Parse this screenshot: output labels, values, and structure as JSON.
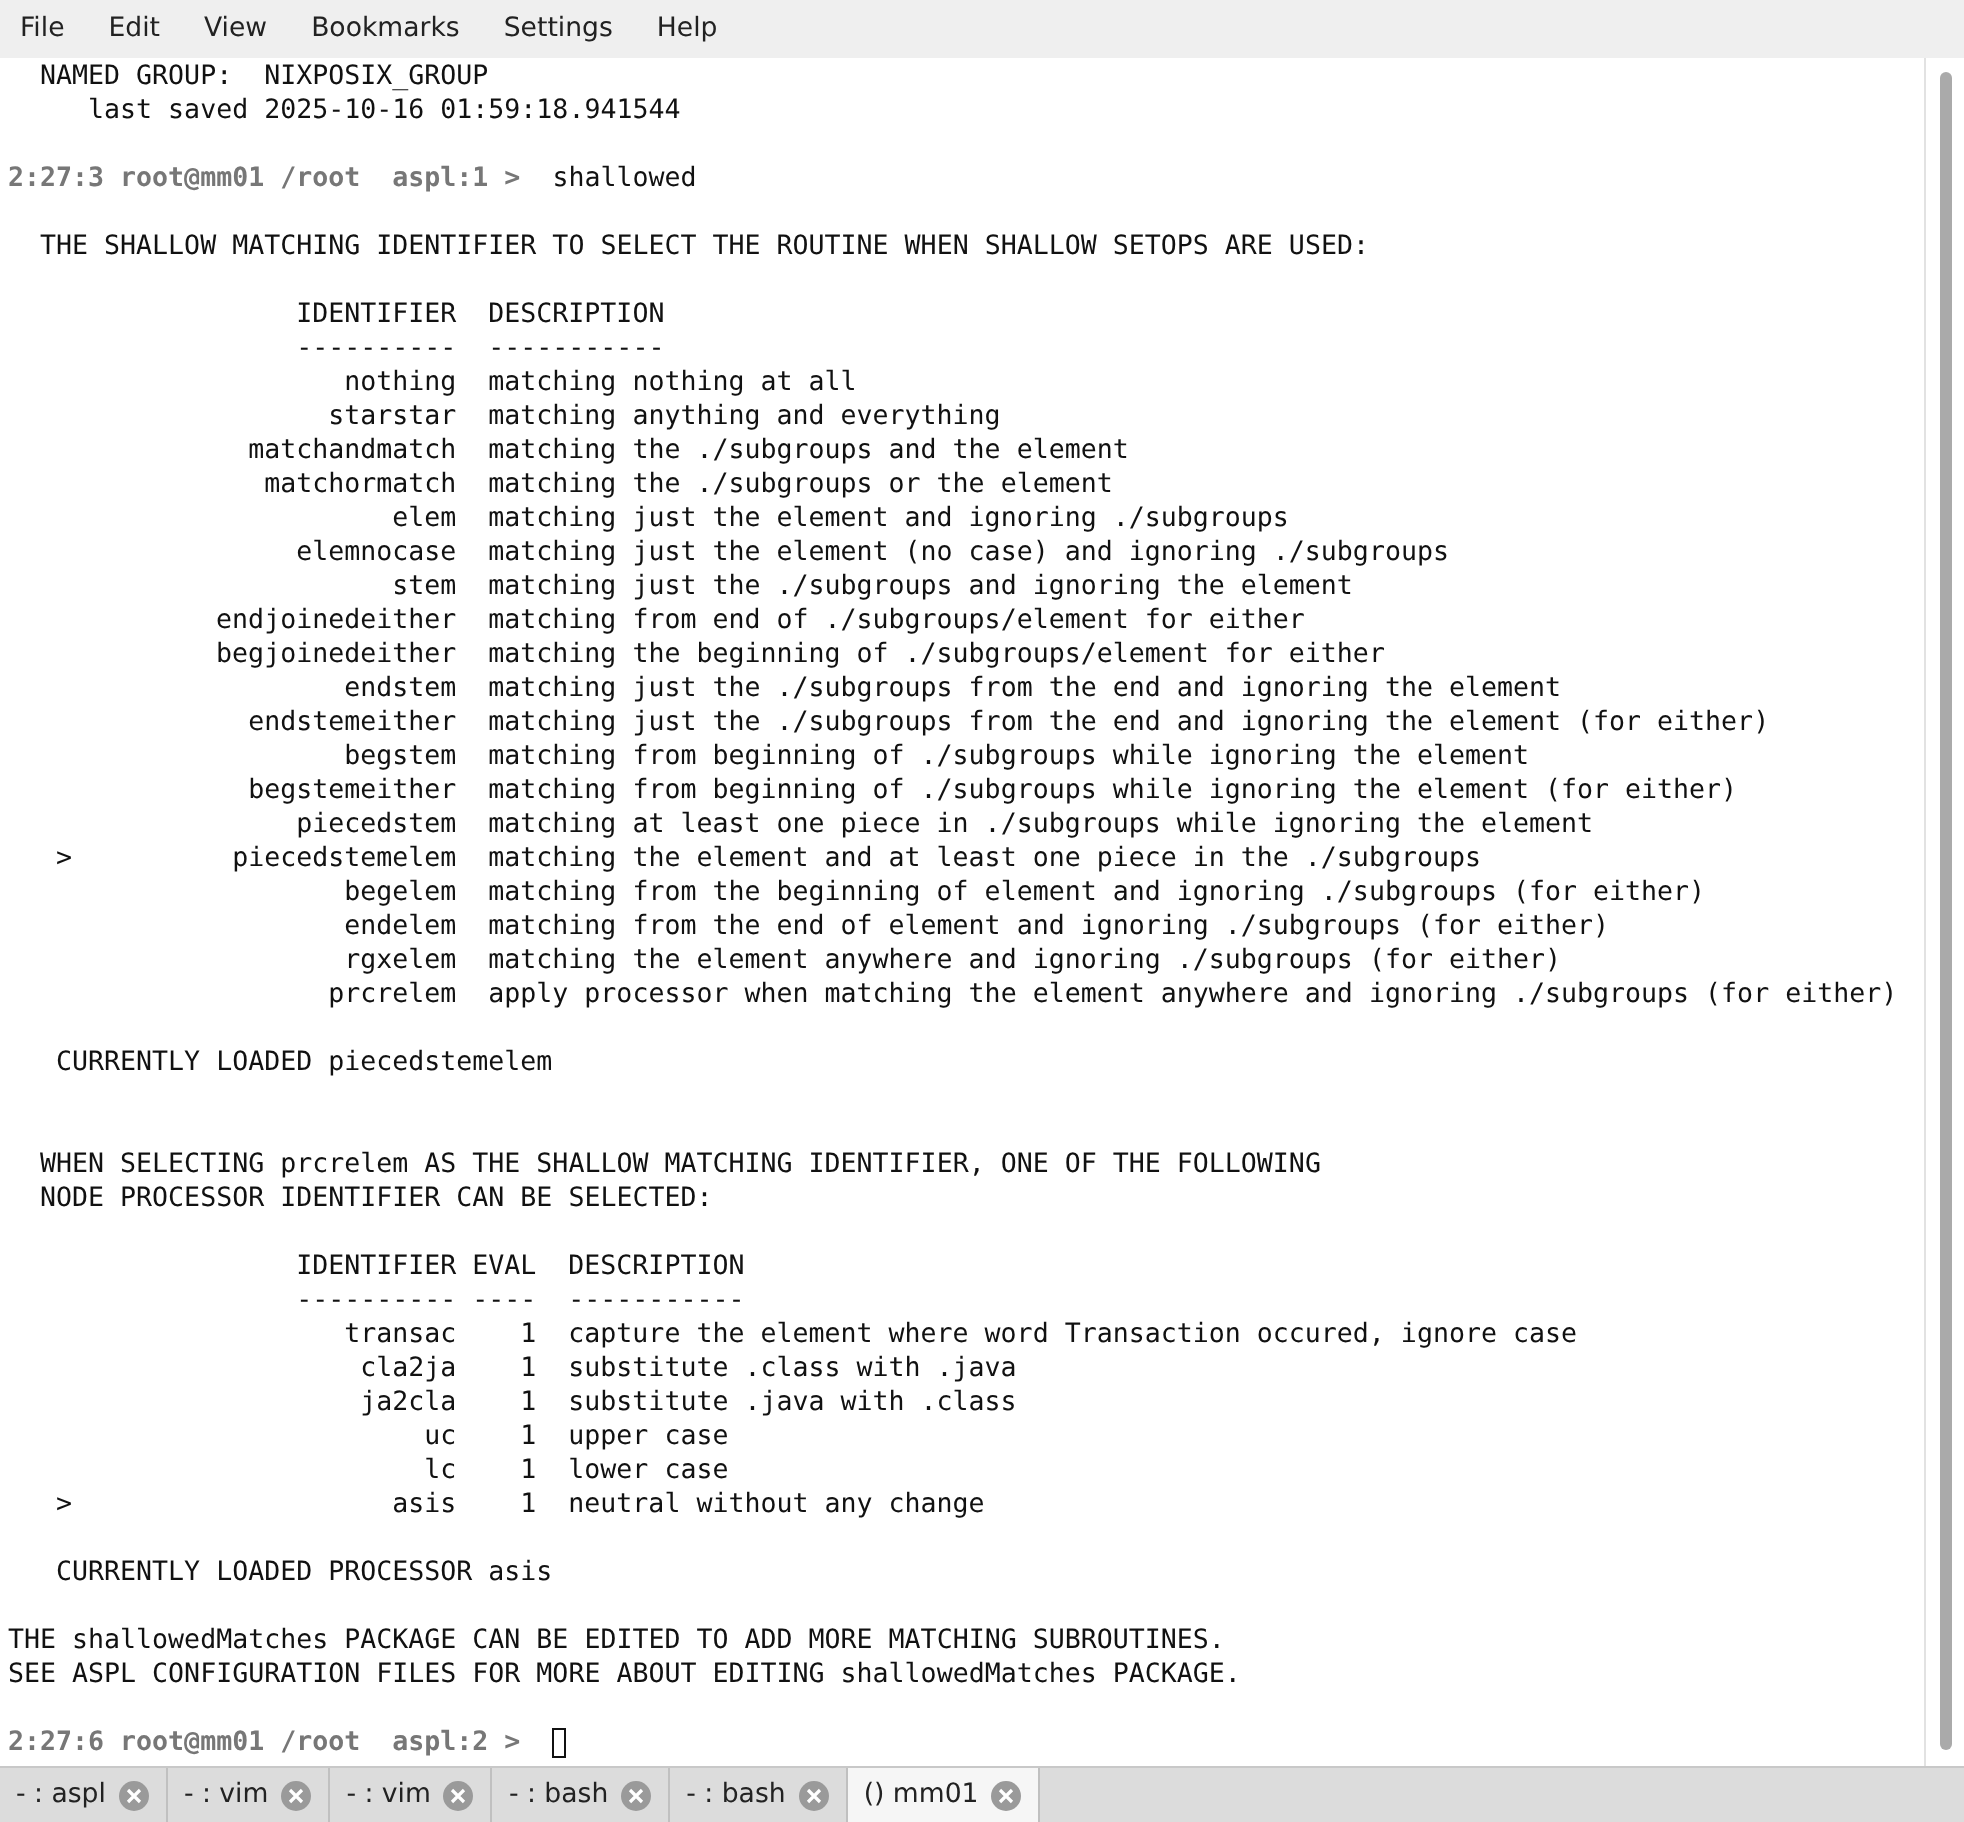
{
  "menu_bar": [
    "File",
    "Edit",
    "View",
    "Bookmarks",
    "Settings",
    "Help"
  ],
  "terminal": [
    {
      "kind": "text",
      "text": "  NAMED GROUP:  NIXPOSIX_GROUP"
    },
    {
      "kind": "text",
      "text": "     last saved 2025-10-16 01:59:18.941544"
    },
    {
      "kind": "blank"
    },
    {
      "kind": "prompt",
      "prompt": "2:27:3 root@mm01 /root  aspl:1 > ",
      "command": " shallowed",
      "cursor": false
    },
    {
      "kind": "blank"
    },
    {
      "kind": "text",
      "text": "  THE SHALLOW MATCHING IDENTIFIER TO SELECT THE ROUTINE WHEN SHALLOW SETOPS ARE USED:"
    },
    {
      "kind": "blank"
    },
    {
      "kind": "table",
      "marker": ">",
      "columns": [
        "IDENTIFIER",
        "DESCRIPTION"
      ],
      "rules": [
        "----------",
        "-----------"
      ],
      "rows": [
        {
          "cells": [
            "nothing",
            "matching nothing at all"
          ],
          "selected": false
        },
        {
          "cells": [
            "starstar",
            "matching anything and everything"
          ],
          "selected": false
        },
        {
          "cells": [
            "matchandmatch",
            "matching the ./subgroups and the element"
          ],
          "selected": false
        },
        {
          "cells": [
            "matchormatch",
            "matching the ./subgroups or the element"
          ],
          "selected": false
        },
        {
          "cells": [
            "elem",
            "matching just the element and ignoring ./subgroups"
          ],
          "selected": false
        },
        {
          "cells": [
            "elemnocase",
            "matching just the element (no case) and ignoring ./subgroups"
          ],
          "selected": false
        },
        {
          "cells": [
            "stem",
            "matching just the ./subgroups and ignoring the element"
          ],
          "selected": false
        },
        {
          "cells": [
            "endjoinedeither",
            "matching from end of ./subgroups/element for either"
          ],
          "selected": false
        },
        {
          "cells": [
            "begjoinedeither",
            "matching the beginning of ./subgroups/element for either"
          ],
          "selected": false
        },
        {
          "cells": [
            "endstem",
            "matching just the ./subgroups from the end and ignoring the element"
          ],
          "selected": false
        },
        {
          "cells": [
            "endstemeither",
            "matching just the ./subgroups from the end and ignoring the element (for either)"
          ],
          "selected": false
        },
        {
          "cells": [
            "begstem",
            "matching from beginning of ./subgroups while ignoring the element"
          ],
          "selected": false
        },
        {
          "cells": [
            "begstemeither",
            "matching from beginning of ./subgroups while ignoring the element (for either)"
          ],
          "selected": false
        },
        {
          "cells": [
            "piecedstem",
            "matching at least one piece in ./subgroups while ignoring the element"
          ],
          "selected": false
        },
        {
          "cells": [
            "piecedstemelem",
            "matching the element and at least one piece in the ./subgroups"
          ],
          "selected": true
        },
        {
          "cells": [
            "begelem",
            "matching from the beginning of element and ignoring ./subgroups (for either)"
          ],
          "selected": false
        },
        {
          "cells": [
            "endelem",
            "matching from the end of element and ignoring ./subgroups (for either)"
          ],
          "selected": false
        },
        {
          "cells": [
            "rgxelem",
            "matching the element anywhere and ignoring ./subgroups (for either)"
          ],
          "selected": false
        },
        {
          "cells": [
            "prcrelem",
            "apply processor when matching the element anywhere and ignoring ./subgroups (for either)"
          ],
          "selected": false
        }
      ]
    },
    {
      "kind": "blank"
    },
    {
      "kind": "text",
      "text": "   CURRENTLY LOADED piecedstemelem"
    },
    {
      "kind": "blank"
    },
    {
      "kind": "blank"
    },
    {
      "kind": "text",
      "text": "  WHEN SELECTING prcrelem AS THE SHALLOW MATCHING IDENTIFIER, ONE OF THE FOLLOWING"
    },
    {
      "kind": "text",
      "text": "  NODE PROCESSOR IDENTIFIER CAN BE SELECTED:"
    },
    {
      "kind": "blank"
    },
    {
      "kind": "table",
      "marker": ">",
      "columns": [
        "IDENTIFIER",
        "EVAL",
        "DESCRIPTION"
      ],
      "rules": [
        "----------",
        "----",
        "-----------"
      ],
      "rows": [
        {
          "cells": [
            "transac",
            "1",
            "capture the element where word Transaction occured, ignore case"
          ],
          "selected": false
        },
        {
          "cells": [
            "cla2ja",
            "1",
            "substitute .class with .java"
          ],
          "selected": false
        },
        {
          "cells": [
            "ja2cla",
            "1",
            "substitute .java with .class"
          ],
          "selected": false
        },
        {
          "cells": [
            "uc",
            "1",
            "upper case"
          ],
          "selected": false
        },
        {
          "cells": [
            "lc",
            "1",
            "lower case"
          ],
          "selected": false
        },
        {
          "cells": [
            "asis",
            "1",
            "neutral without any change"
          ],
          "selected": true
        }
      ]
    },
    {
      "kind": "blank"
    },
    {
      "kind": "text",
      "text": "   CURRENTLY LOADED PROCESSOR asis"
    },
    {
      "kind": "blank"
    },
    {
      "kind": "text",
      "text": "THE shallowedMatches PACKAGE CAN BE EDITED TO ADD MORE MATCHING SUBROUTINES."
    },
    {
      "kind": "text",
      "text": "SEE ASPL CONFIGURATION FILES FOR MORE ABOUT EDITING shallowedMatches PACKAGE."
    },
    {
      "kind": "blank"
    },
    {
      "kind": "prompt",
      "prompt": "2:27:6 root@mm01 /root  aspl:2 > ",
      "cursor": true
    }
  ],
  "tabs": [
    {
      "label": "- : aspl",
      "selected": false
    },
    {
      "label": "- : vim",
      "selected": false
    },
    {
      "label": "- : vim",
      "selected": false
    },
    {
      "label": "- : bash",
      "selected": false
    },
    {
      "label": "- : bash",
      "selected": false
    },
    {
      "label": "() mm01",
      "selected": true
    }
  ]
}
